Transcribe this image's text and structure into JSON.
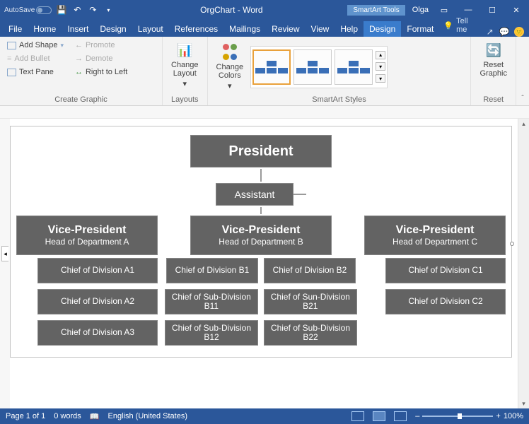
{
  "titlebar": {
    "autosave": "AutoSave",
    "doc_title": "OrgChart - Word",
    "smartart_tools": "SmartArt Tools",
    "username": "Olga"
  },
  "tabs": {
    "file": "File",
    "home": "Home",
    "insert": "Insert",
    "design_main": "Design",
    "layout": "Layout",
    "references": "References",
    "mailings": "Mailings",
    "review": "Review",
    "view": "View",
    "help": "Help",
    "design": "Design",
    "format": "Format",
    "tellme": "Tell me"
  },
  "ribbon": {
    "create_graphic": {
      "label": "Create Graphic",
      "add_shape": "Add Shape",
      "add_bullet": "Add Bullet",
      "text_pane": "Text Pane",
      "promote": "Promote",
      "demote": "Demote",
      "rtl": "Right to Left"
    },
    "layouts": {
      "label": "Layouts",
      "change_layout": "Change\nLayout"
    },
    "styles": {
      "label": "SmartArt Styles",
      "change_colors": "Change\nColors"
    },
    "reset": {
      "label": "Reset",
      "reset_graphic": "Reset\nGraphic"
    }
  },
  "org": {
    "president": "President",
    "assistant": "Assistant",
    "vp": [
      {
        "title": "Vice-President",
        "sub": "Head of Department A"
      },
      {
        "title": "Vice-President",
        "sub": "Head of Department B"
      },
      {
        "title": "Vice-President",
        "sub": "Head of Department C"
      }
    ],
    "a": [
      "Chief of Division A1",
      "Chief of Division A2",
      "Chief of Division A3"
    ],
    "b_heads": [
      "Chief of Division B1",
      "Chief of Division B2"
    ],
    "b_sub1": [
      "Chief of Sub-Division B11",
      "Chief of Sun-Division B21"
    ],
    "b_sub2": [
      "Chief of Sub-Division B12",
      "Chief of Sub-Division B22"
    ],
    "c": [
      "Chief of Division C1",
      "Chief of Division C2"
    ]
  },
  "status": {
    "page": "Page 1 of 1",
    "words": "0 words",
    "lang": "English (United States)",
    "zoom": "100%"
  },
  "icons": {
    "expand": "◂",
    "search": "🔍",
    "minus": "–",
    "plus": "+"
  }
}
